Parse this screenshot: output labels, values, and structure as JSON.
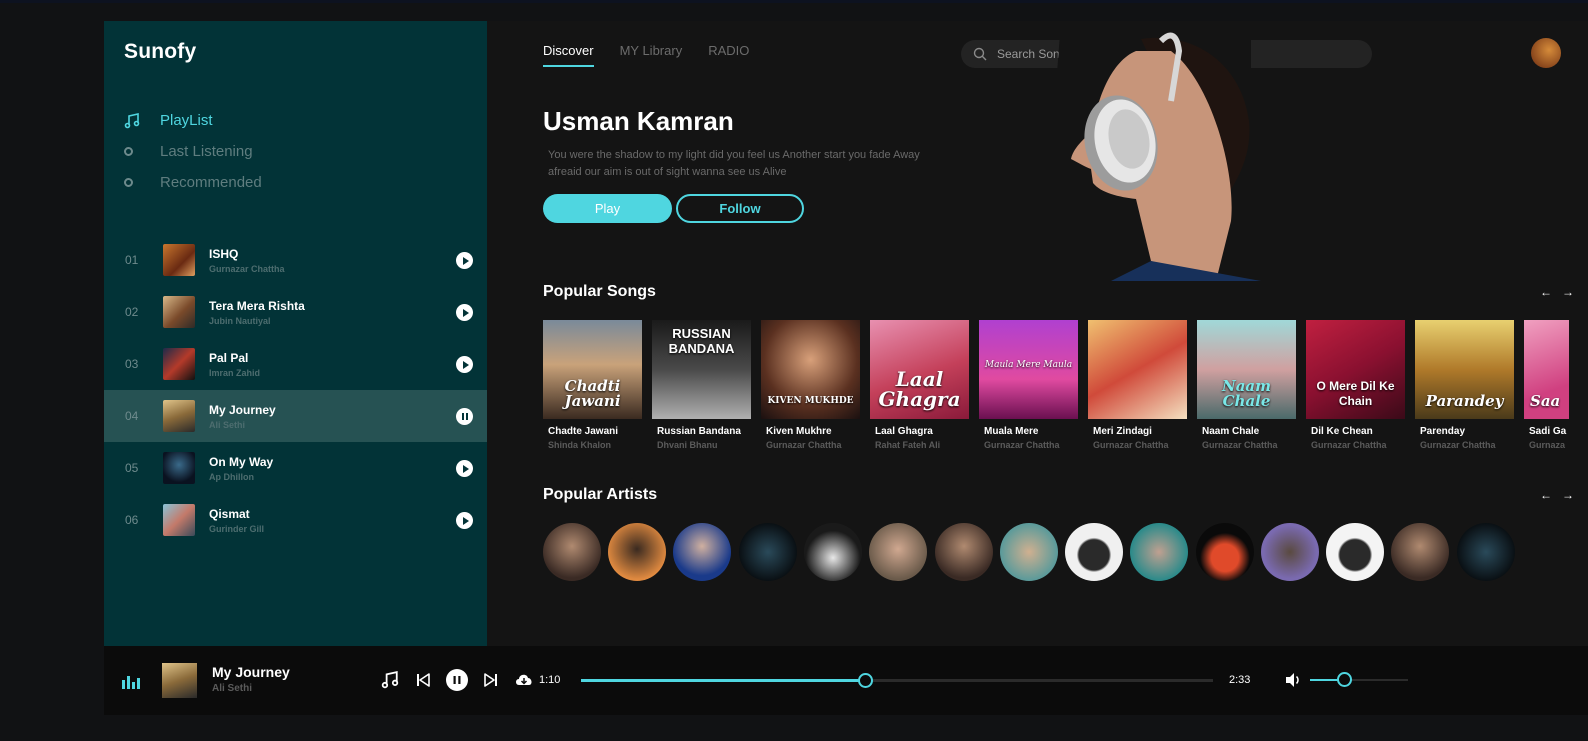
{
  "app": {
    "name": "Sunofy"
  },
  "sidebar": {
    "nav": [
      {
        "label": "PlayList",
        "active": true
      },
      {
        "label": "Last Listening",
        "active": false
      },
      {
        "label": "Recommended",
        "active": false
      }
    ],
    "tracks": [
      {
        "num": "01",
        "title": "ISHQ",
        "artist": "Gurnazar Chattha",
        "state": "play"
      },
      {
        "num": "02",
        "title": "Tera Mera Rishta",
        "artist": "Jubin Nautiyal",
        "state": "play"
      },
      {
        "num": "03",
        "title": "Pal Pal",
        "artist": "Imran Zahid",
        "state": "play"
      },
      {
        "num": "04",
        "title": "My Journey",
        "artist": "Ali Sethi",
        "state": "pause"
      },
      {
        "num": "05",
        "title": "On My Way",
        "artist": "Ap Dhillon",
        "state": "play"
      },
      {
        "num": "06",
        "title": "Qismat",
        "artist": "Gurinder Gill",
        "state": "play"
      }
    ]
  },
  "header": {
    "tabs": [
      {
        "label": "Discover",
        "active": true
      },
      {
        "label": "MY Library",
        "active": false
      },
      {
        "label": "RADIO",
        "active": false
      }
    ],
    "search_placeholder": "Search Songs....",
    "search_icon": "search-icon"
  },
  "hero": {
    "title": "Usman Kamran",
    "description": "You were the shadow to my light did you feel us Another start you fade Away afreaid our aim is out of sight wanna see us Alive",
    "play_label": "Play",
    "follow_label": "Follow"
  },
  "popular_songs": {
    "title": "Popular Songs",
    "items": [
      {
        "title": "Chadte Jawani",
        "artist": "Shinda Khalon",
        "cover_text": "Chadti Jawani"
      },
      {
        "title": "Russian Bandana",
        "artist": "Dhvani Bhanu",
        "cover_text": "RUSSIAN BANDANA"
      },
      {
        "title": "Kiven Mukhre",
        "artist": "Gurnazar Chattha",
        "cover_text": "KIVEN MUKHDE"
      },
      {
        "title": "Laal Ghagra",
        "artist": "Rahat Fateh Ali",
        "cover_text": "Laal Ghagra"
      },
      {
        "title": "Muala Mere",
        "artist": "Gurnazar Chattha",
        "cover_text": "Maula Mere Maula"
      },
      {
        "title": "Meri Zindagi",
        "artist": "Gurnazar Chattha",
        "cover_text": ""
      },
      {
        "title": "Naam Chale",
        "artist": "Gurnazar Chattha",
        "cover_text": "Naam Chale"
      },
      {
        "title": "Dil Ke Chean",
        "artist": "Gurnazar Chattha",
        "cover_text": "O Mere Dil Ke Chain"
      },
      {
        "title": "Parenday",
        "artist": "Gurnazar Chattha",
        "cover_text": "Parandey"
      },
      {
        "title": "Sadi Ga",
        "artist": "Gurnaza",
        "cover_text": "Saa"
      }
    ]
  },
  "popular_artists": {
    "title": "Popular Artists",
    "count": 15
  },
  "player": {
    "title": "My Journey",
    "artist": "Ali Sethi",
    "current_time": "1:10",
    "total_time": "2:33",
    "progress": 0.45,
    "volume": 0.35
  },
  "colors": {
    "accent": "#4fd6e0",
    "sidebar": "#023337",
    "background": "#141414"
  }
}
